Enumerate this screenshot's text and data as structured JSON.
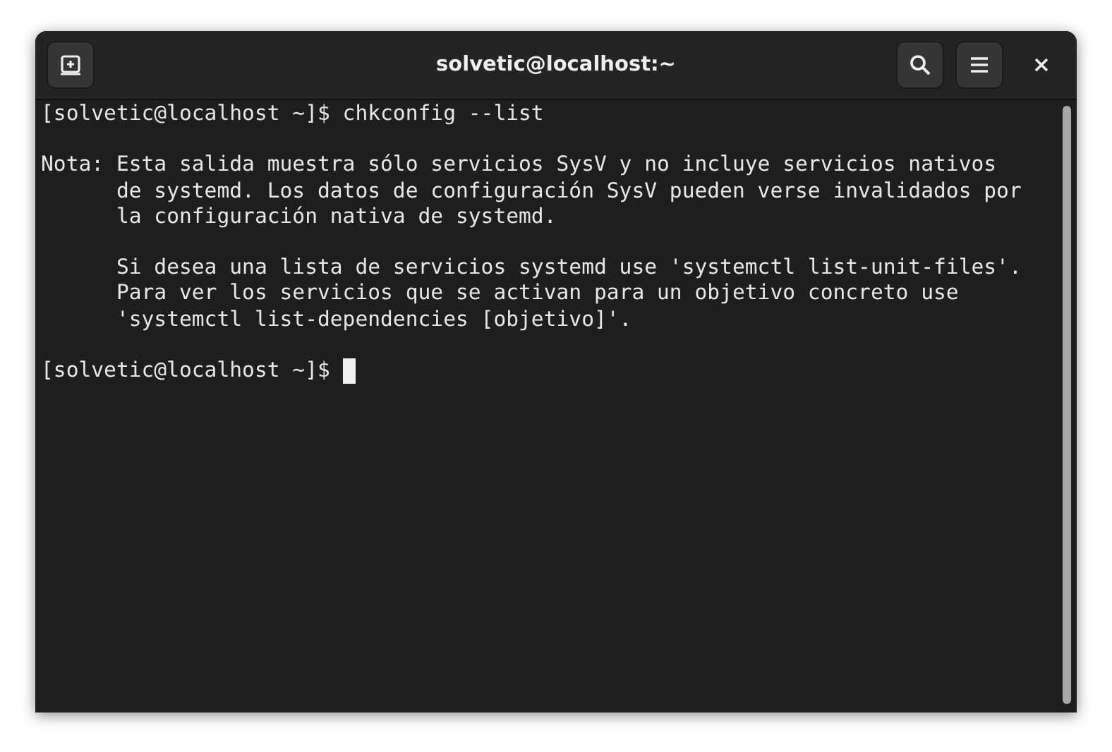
{
  "window": {
    "title": "solvetic@localhost:~"
  },
  "terminal": {
    "lines": [
      {
        "kind": "text",
        "text": "[solvetic@localhost ~]$ chkconfig --list",
        "cursor": false
      },
      {
        "kind": "blank"
      },
      {
        "kind": "text",
        "text": "Nota: Esta salida muestra sólo servicios SysV y no incluye servicios nativos",
        "cursor": false
      },
      {
        "kind": "text",
        "text": "      de systemd. Los datos de configuración SysV pueden verse invalidados por",
        "cursor": false
      },
      {
        "kind": "text",
        "text": "      la configuración nativa de systemd.",
        "cursor": false
      },
      {
        "kind": "blank"
      },
      {
        "kind": "text",
        "text": "      Si desea una lista de servicios systemd use 'systemctl list-unit-files'.",
        "cursor": false
      },
      {
        "kind": "text",
        "text": "      Para ver los servicios que se activan para un objetivo concreto use",
        "cursor": false
      },
      {
        "kind": "text",
        "text": "      'systemctl list-dependencies [objetivo]'.",
        "cursor": false
      },
      {
        "kind": "blank"
      },
      {
        "kind": "text",
        "text": "[solvetic@localhost ~]$ ",
        "cursor": true
      }
    ]
  }
}
